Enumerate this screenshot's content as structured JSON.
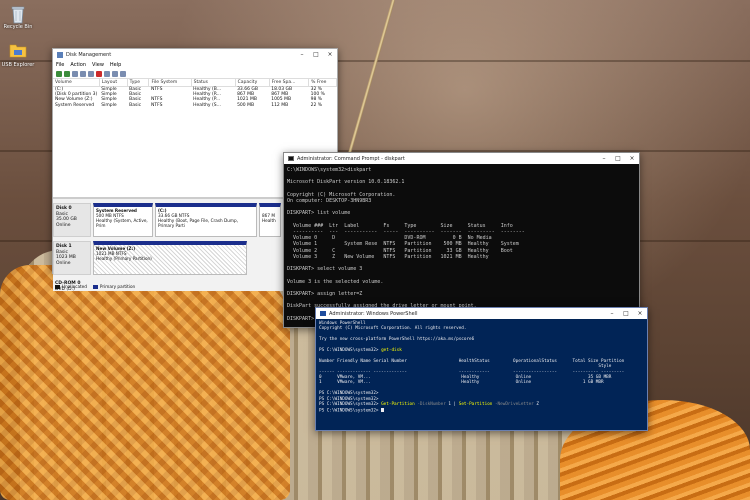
{
  "desktop": {
    "icons": [
      {
        "label": "Recycle Bin"
      },
      {
        "label": "USB Explorer"
      }
    ]
  },
  "disk_management": {
    "title": "Disk Management",
    "menu": [
      "File",
      "Action",
      "View",
      "Help"
    ],
    "columns": [
      "Volume",
      "Layout",
      "Type",
      "File System",
      "Status",
      "Capacity",
      "Free Spa...",
      "% Free"
    ],
    "rows": [
      [
        "(C:)",
        "Simple",
        "Basic",
        "NTFS",
        "Healthy (B...",
        "33.66 GB",
        "18.03 GB",
        "32 %"
      ],
      [
        "(Disk 0 partition 3)",
        "Simple",
        "Basic",
        "",
        "Healthy (R...",
        "867 MB",
        "867 MB",
        "100 %"
      ],
      [
        "New Volume (Z:)",
        "Simple",
        "Basic",
        "NTFS",
        "Healthy (P...",
        "1021 MB",
        "1005 MB",
        "98 %"
      ],
      [
        "System Reserved",
        "Simple",
        "Basic",
        "NTFS",
        "Healthy (S...",
        "500 MB",
        "112 MB",
        "22 %"
      ]
    ],
    "disks": [
      {
        "name": "Disk 0",
        "type": "Basic",
        "size": "35.00 GB",
        "state": "Online",
        "partitions": [
          {
            "name": "System Reserved",
            "size": "500 MB NTFS",
            "status": "Healthy (System, Active, Prim"
          },
          {
            "name": "(C:)",
            "size": "33.66 GB NTFS",
            "status": "Healthy (Boot, Page File, Crash Dump, Primary Parti"
          },
          {
            "name": "",
            "size": "867 M",
            "status": "Health"
          }
        ]
      },
      {
        "name": "Disk 1",
        "type": "Basic",
        "size": "1023 MB",
        "state": "Online",
        "partitions": [
          {
            "name": "New Volume (Z:)",
            "size": "1021 MB NTFS",
            "status": "Healthy (Primary Partition)"
          }
        ]
      }
    ],
    "cdrom": {
      "name": "CD-ROM 0",
      "type": "DVD (D:)"
    },
    "legend": [
      "Unallocated",
      "Primary partition"
    ]
  },
  "cmd": {
    "title": "Administrator: Command Prompt - diskpart",
    "lines": [
      "C:\\WINDOWS\\system32>diskpart",
      "",
      "Microsoft DiskPart version 10.0.18362.1",
      "",
      "Copyright (C) Microsoft Corporation.",
      "On computer: DESKTOP-3HN9BR3",
      "",
      "DISKPART> list volume",
      "",
      "  Volume ###  Ltr  Label        Fs     Type        Size     Status     Info",
      "  ----------  ---  -----------  -----  ----------  -------  ---------  --------",
      "  Volume 0     D                       DVD-ROM         0 B  No Media",
      "  Volume 1         System Rese  NTFS   Partition    500 MB  Healthy    System",
      "  Volume 2     C                NTFS   Partition     33 GB  Healthy    Boot",
      "  Volume 3     Z   New Volume   NTFS   Partition   1021 MB  Healthy",
      "",
      "DISKPART> select volume 3",
      "",
      "Volume 3 is the selected volume.",
      "",
      "DISKPART> assign letter=Z",
      "",
      "DiskPart successfully assigned the drive letter or mount point.",
      "",
      "DISKPART> e",
      "",
      "DiskPart su"
    ]
  },
  "powershell": {
    "title": "Administrator: Windows PowerShell",
    "header": [
      "Windows PowerShell",
      "Copyright (C) Microsoft Corporation. All rights reserved.",
      "",
      "Try the new cross-platform PowerShell https://aka.ms/pscore6",
      "",
      "PS C:\\WINDOWS\\system32> "
    ],
    "get_disk": "get-disk",
    "table": [
      "",
      "Number Friendly Name Serial Number                    HealthStatus         OperationalStatus      Total Size Partition",
      "                                                                                                            Style",
      "------ ------------- -------------                    ------------         -----------------      ---------- ---------",
      "0      VMware, VM...                                   Healthy              Online                      35 GB MBR",
      "1      VMware, VM...                                   Healthy              Online                    1 GB MBR",
      ""
    ],
    "prompt": "PS C:\\WINDOWS\\system32>",
    "cmd_get_partition": "Get-Partition",
    "param_disknumber": "-DiskNumber",
    "disknumber_value": " 1 | ",
    "cmd_set_partition": "Set-Partition",
    "param_newdriveletter": "-NewDriveLetter",
    "driveletter_value": " Z"
  }
}
